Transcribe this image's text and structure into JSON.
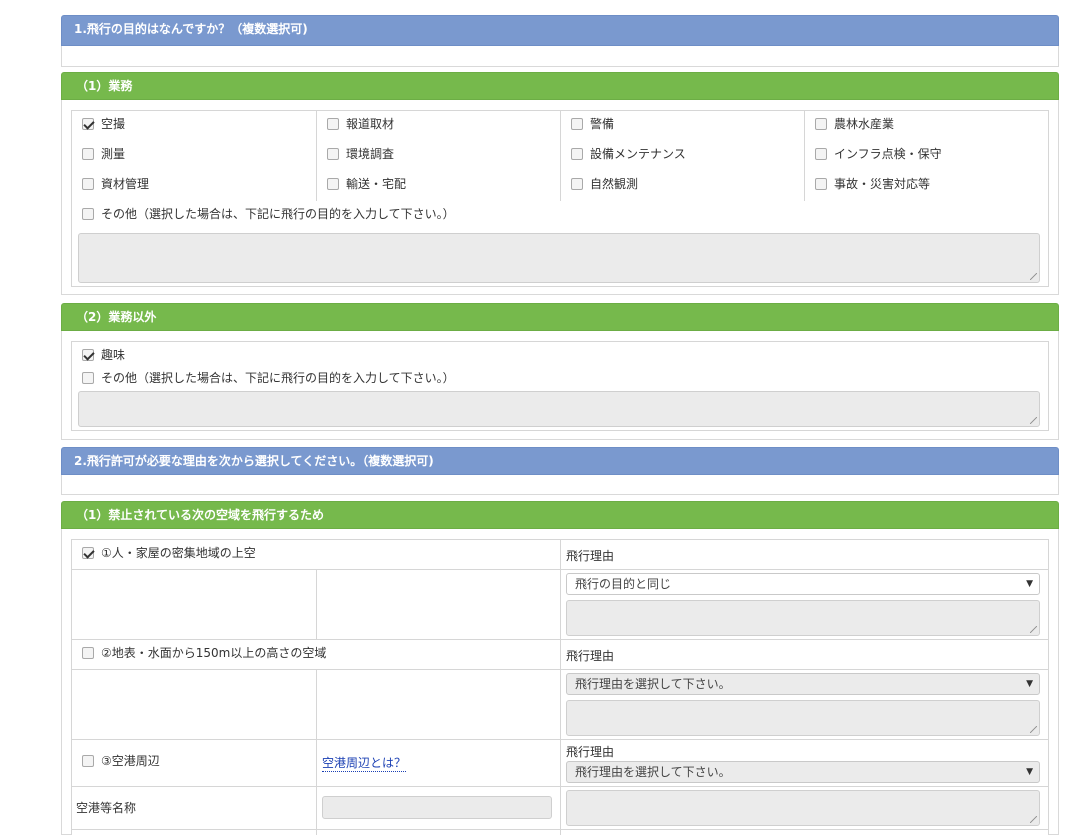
{
  "q1": {
    "title": "1.飛行の目的はなんですか？（複数選択可)",
    "business": {
      "title": "（1）業務",
      "options": [
        {
          "label": "空撮",
          "checked": true
        },
        {
          "label": "報道取材",
          "checked": false
        },
        {
          "label": "警備",
          "checked": false
        },
        {
          "label": "農林水産業",
          "checked": false
        },
        {
          "label": "測量",
          "checked": false
        },
        {
          "label": "環境調査",
          "checked": false
        },
        {
          "label": "設備メンテナンス",
          "checked": false
        },
        {
          "label": "インフラ点検・保守",
          "checked": false
        },
        {
          "label": "資材管理",
          "checked": false
        },
        {
          "label": "輸送・宅配",
          "checked": false
        },
        {
          "label": "自然観測",
          "checked": false
        },
        {
          "label": "事故・災害対応等",
          "checked": false
        }
      ],
      "other_label": "その他（選択した場合は、下記に飛行の目的を入力して下さい。）",
      "other_checked": false,
      "other_text": ""
    },
    "nonbusiness": {
      "title": "（2）業務以外",
      "hobby_label": "趣味",
      "hobby_checked": true,
      "other_label": "その他（選択した場合は、下記に飛行の目的を入力して下さい。）",
      "other_checked": false,
      "other_text": ""
    }
  },
  "q2": {
    "title": "2.飛行許可が必要な理由を次から選択してください。（複数選択可)",
    "prohibited": {
      "title": "（1）禁止されている次の空域を飛行するため",
      "items": [
        {
          "label": "①人・家屋の密集地域の上空",
          "checked": true,
          "reason_label": "飛行理由",
          "reason_value": "飛行の目的と同じ"
        },
        {
          "label": "②地表・水面から150m以上の高さの空域",
          "checked": false,
          "reason_label": "飛行理由",
          "reason_value": "飛行理由を選択して下さい。"
        },
        {
          "label": "③空港周辺",
          "checked": false,
          "link_label": "空港周辺とは？",
          "reason_label": "飛行理由",
          "reason_value": "飛行理由を選択して下さい。"
        }
      ],
      "airport_name_label": "空港等名称",
      "airport_name_value": ""
    }
  },
  "colors": {
    "blue_header": "#7a99cf",
    "green_header": "#76b94c"
  }
}
